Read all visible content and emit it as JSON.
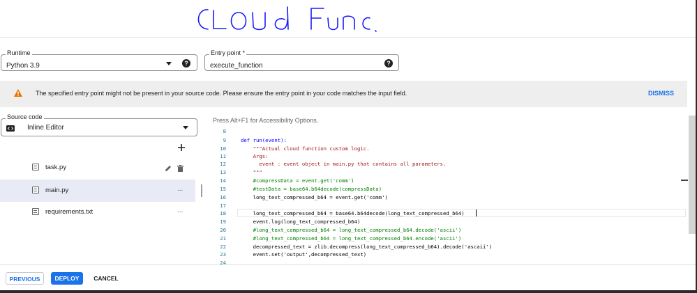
{
  "annotation": {
    "text": "CLOUd Func."
  },
  "runtime": {
    "label": "Runtime",
    "value": "Python 3.9"
  },
  "entry_point": {
    "label": "Entry point *",
    "value": "execute_function"
  },
  "banner": {
    "message": "The specified entry point might not be present in your source code. Please ensure the entry point in your code matches the input field.",
    "dismiss_label": "DISMISS"
  },
  "source_code": {
    "label": "Source code",
    "value": "Inline Editor"
  },
  "files": [
    {
      "name": "task.py"
    },
    {
      "name": "main.py",
      "menu": "..."
    },
    {
      "name": "requirements.txt",
      "menu": "..."
    }
  ],
  "editor": {
    "accessibility_hint": "Press Alt+F1 for Accessibility Options.",
    "line_numbers": [
      "8",
      "9",
      "10",
      "11",
      "12",
      "13",
      "14",
      "15",
      "16",
      "17",
      "18",
      "19",
      "20",
      "21",
      "22",
      "23",
      "24"
    ],
    "lines": [
      "",
      "def run(event):",
      "    \"\"\"Actual cloud function custom logic.",
      "    Args:",
      "      event : event object in main.py that contains all parameters.",
      "    \"\"\"",
      "    #compressData = event.get('comm')",
      "    #testData = base64.b64decode(compressData)",
      "    long_text_compressed_b64 = event.get('comm')",
      "",
      "    long_text_compressed_b64 = base64.b64decode(long_text_compressed_b64)",
      "    event.log(long_text_compressed_b64)",
      "    #long_text_compressed_b64 = long_text_compressed_b64.decode('ascii')",
      "    #long_text_compressed_b64 = long_text_compressed_b64.encode('ascii')",
      "    decompressed_text = zlib.decompress(long_text_compressed_b64).decode('ascaii')",
      "    event.set('output',decompressed_text)",
      ""
    ]
  },
  "actions": {
    "previous": "PREVIOUS",
    "deploy": "DEPLOY",
    "cancel": "CANCEL"
  },
  "colors": {
    "accent": "#1a73e8",
    "warning": "#e37400",
    "annotation_ink": "#1a1aff"
  },
  "icons": {
    "help": "help-circle-icon",
    "warning": "warning-triangle-icon",
    "editor": "code-editor-icon",
    "add": "add-icon",
    "edit": "pencil-icon",
    "delete": "trash-icon",
    "file": "file-icon"
  }
}
